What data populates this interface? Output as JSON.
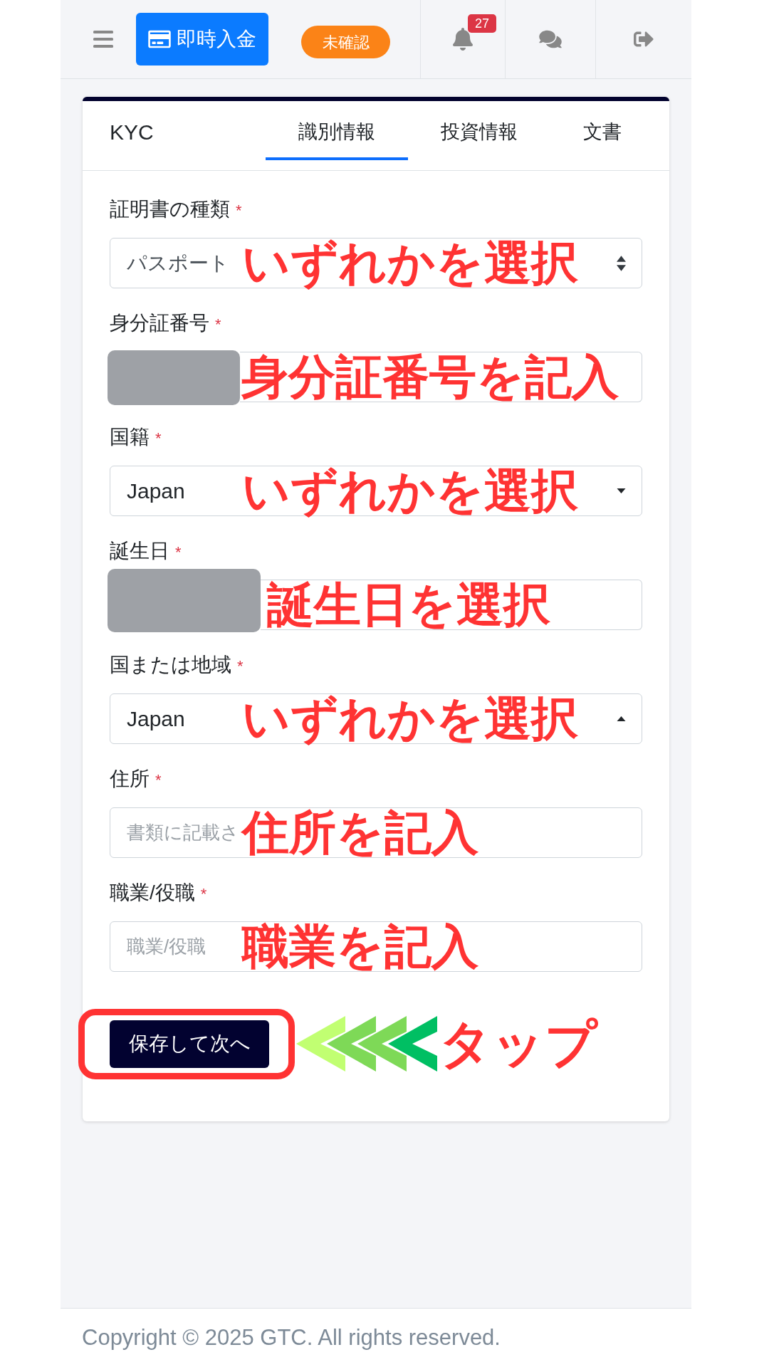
{
  "topbar": {
    "deposit_button": {
      "label": "即時入金"
    },
    "status_badge": "未確認",
    "notification_count": "27"
  },
  "card": {
    "title": "KYC",
    "tabs": [
      {
        "label": "識別情報",
        "selected": true
      },
      {
        "label": "投資情報",
        "selected": false
      },
      {
        "label": "文書",
        "selected": false
      }
    ]
  },
  "form": {
    "fields": [
      {
        "kind": "select",
        "label": "証明書の種類",
        "required_mark": "*",
        "value": "パスポート",
        "redacted": false,
        "annotation": "いずれかを選択"
      },
      {
        "kind": "text",
        "label": "身分証番号",
        "required_mark": "*",
        "redacted": true,
        "annotation": "身分証番号を記入"
      },
      {
        "kind": "combobox",
        "label": "国籍",
        "required_mark": "*",
        "value": "Japan",
        "expanded": false,
        "redacted": false,
        "annotation": "いずれかを選択"
      },
      {
        "kind": "date",
        "label": "誕生日",
        "required_mark": "*",
        "redacted": true,
        "annotation": "誕生日を選択"
      },
      {
        "kind": "combobox",
        "label": "国または地域",
        "required_mark": "*",
        "value": "Japan",
        "expanded": true,
        "redacted": false,
        "annotation": "いずれかを選択"
      },
      {
        "kind": "text",
        "label": "住所",
        "required_mark": "*",
        "placeholder": "書類に記載さ",
        "redacted": false,
        "annotation": "住所を記入"
      },
      {
        "kind": "text",
        "label": "職業/役職",
        "required_mark": "*",
        "placeholder": "職業/役職",
        "redacted": false,
        "annotation": "職業を記入"
      }
    ],
    "submit": {
      "label": "保存して次へ",
      "highlighted": true
    }
  },
  "tap_hint": {
    "text": "タップ",
    "chevrons": [
      {
        "color": "#c1ff72"
      },
      {
        "color": "#7ed957"
      },
      {
        "color": "#7ed957"
      },
      {
        "color": "#00bf63"
      }
    ]
  },
  "footer": {
    "copyright": "Copyright © 2025 GTC. All rights reserved."
  }
}
